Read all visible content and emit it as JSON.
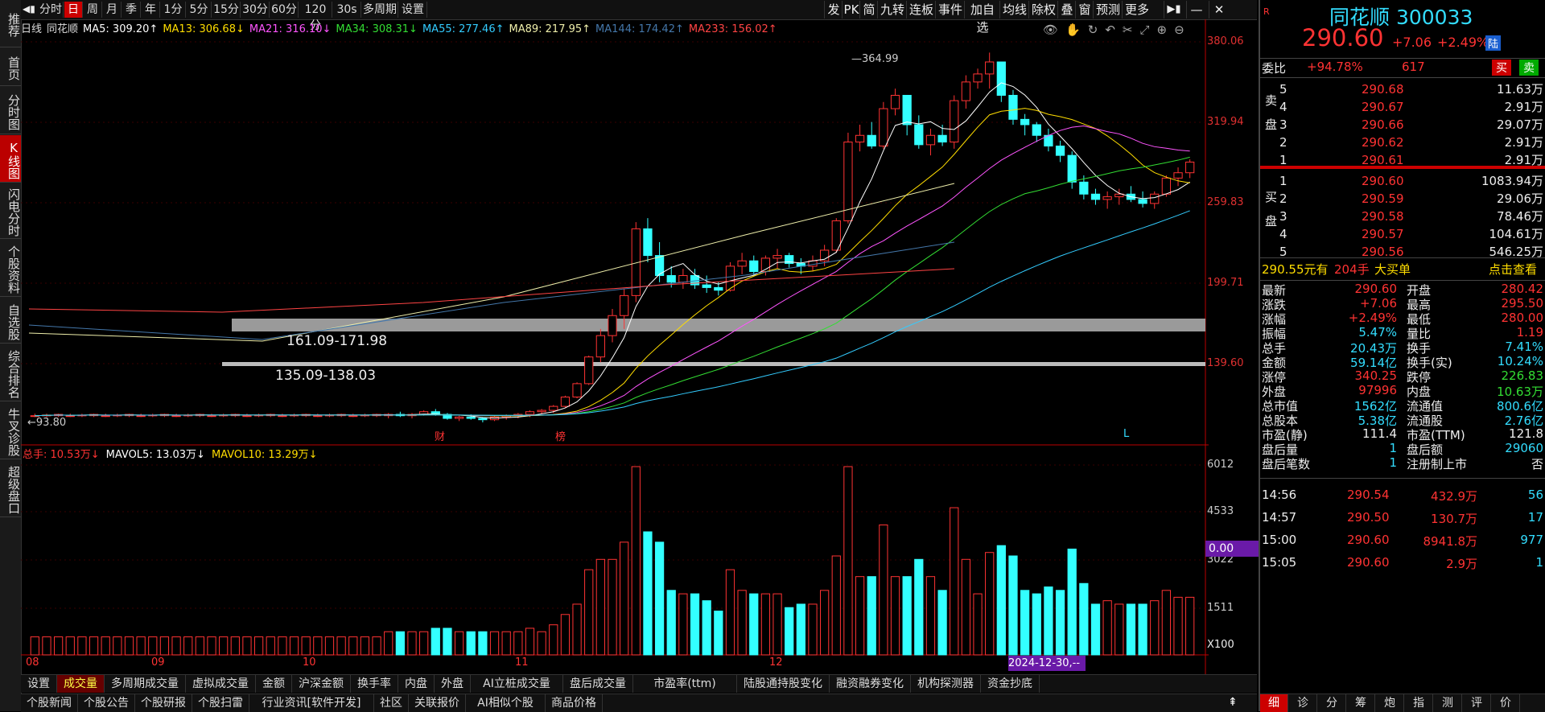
{
  "leftnav": [
    {
      "label": "推荐",
      "active": false
    },
    {
      "label": "首页",
      "active": false
    },
    {
      "label": "分时图",
      "active": false
    },
    {
      "label": "K线图",
      "active": true
    },
    {
      "label": "闪电分时",
      "active": false
    },
    {
      "label": "个股资料",
      "active": false
    },
    {
      "label": "自选股",
      "active": false
    },
    {
      "label": "综合排名",
      "active": false
    },
    {
      "label": "牛叉诊股",
      "active": false
    },
    {
      "label": "超级盘口",
      "active": false
    }
  ],
  "toolbar": {
    "periods": [
      "分时",
      "日",
      "周",
      "月",
      "季",
      "年",
      "1分",
      "5分",
      "15分",
      "30分",
      "60分",
      "120分",
      "30s",
      "多周期",
      "设置"
    ],
    "active_period": "日",
    "right_items": [
      "发",
      "PK",
      "简",
      "九转",
      "连板",
      "事件",
      "加自选",
      "均线",
      "除权",
      "叠",
      "窗",
      "预测",
      "更多"
    ]
  },
  "malegend": [
    {
      "text": "日线",
      "color": "#dddddd"
    },
    {
      "text": "同花顺",
      "color": "#dddddd"
    },
    {
      "text": "MA5: 309.20↑",
      "color": "#ffffff"
    },
    {
      "text": "MA13: 306.68↓",
      "color": "#ffdd00"
    },
    {
      "text": "MA21: 316.10↓",
      "color": "#ff55ff"
    },
    {
      "text": "MA34: 308.31↓",
      "color": "#33dd33"
    },
    {
      "text": "MA55: 277.46↑",
      "color": "#33ccff"
    },
    {
      "text": "MA89: 217.95↑",
      "color": "#eeeeaa"
    },
    {
      "text": "MA144: 174.42↑",
      "color": "#4477aa"
    },
    {
      "text": "MA233: 156.02↑",
      "color": "#ff4444"
    }
  ],
  "price_axis": [
    "380.06",
    "319.94",
    "259.83",
    "199.71",
    "139.60"
  ],
  "volume_axis": [
    "6012",
    "4533",
    "3022",
    "1511",
    "X100"
  ],
  "vol_legend": [
    {
      "text": "总手: 10.53万↓",
      "color": "#ff3333"
    },
    {
      "text": "MAVOL5: 13.03万↓",
      "color": "#ffffff"
    },
    {
      "text": "MAVOL10: 13.29万↓",
      "color": "#ffdd00"
    }
  ],
  "annotations": {
    "high": "364.99",
    "low": "93.80",
    "zone1": "161.09-171.98",
    "zone2": "135.09-138.03",
    "marker_cai": "财",
    "marker_bang": "榜",
    "marker_l": "L",
    "cursor_value": "0.00"
  },
  "date_axis": [
    "08",
    "09",
    "10",
    "11",
    "12"
  ],
  "date_highlight": "2024-12-30,--",
  "chart_data": {
    "type": "candlestick",
    "ylim": [
      93.8,
      380.06
    ],
    "candles": [
      [
        100,
        102,
        98,
        101
      ],
      [
        101,
        103,
        99,
        100
      ],
      [
        100,
        102,
        98,
        101
      ],
      [
        101,
        104,
        100,
        103
      ],
      [
        103,
        105,
        100,
        101
      ],
      [
        101,
        102,
        97,
        98
      ],
      [
        98,
        100,
        96,
        99
      ],
      [
        99,
        101,
        97,
        98
      ],
      [
        98,
        99,
        95,
        97
      ],
      [
        97,
        100,
        96,
        99
      ],
      [
        99,
        101,
        97,
        100
      ],
      [
        100,
        102,
        98,
        101
      ],
      [
        101,
        104,
        99,
        103
      ],
      [
        103,
        105,
        101,
        104
      ],
      [
        104,
        108,
        102,
        107
      ],
      [
        107,
        115,
        106,
        114
      ],
      [
        114,
        125,
        113,
        124
      ],
      [
        124,
        145,
        123,
        144
      ],
      [
        144,
        165,
        140,
        160
      ],
      [
        160,
        180,
        155,
        175
      ],
      [
        175,
        195,
        165,
        190
      ],
      [
        190,
        245,
        185,
        240
      ],
      [
        240,
        248,
        215,
        220
      ],
      [
        220,
        230,
        200,
        205
      ],
      [
        205,
        212,
        196,
        200
      ],
      [
        200,
        210,
        195,
        205
      ],
      [
        205,
        210,
        195,
        198
      ],
      [
        198,
        205,
        192,
        196
      ],
      [
        196,
        200,
        190,
        194
      ],
      [
        194,
        215,
        193,
        212
      ],
      [
        212,
        222,
        206,
        216
      ],
      [
        216,
        220,
        205,
        208
      ],
      [
        208,
        220,
        205,
        218
      ],
      [
        218,
        225,
        210,
        220
      ],
      [
        220,
        222,
        211,
        214
      ],
      [
        214,
        218,
        206,
        212
      ],
      [
        212,
        220,
        208,
        216
      ],
      [
        216,
        228,
        212,
        224
      ],
      [
        224,
        248,
        222,
        246
      ],
      [
        246,
        312,
        244,
        305
      ],
      [
        305,
        318,
        298,
        310
      ],
      [
        310,
        320,
        300,
        302
      ],
      [
        302,
        335,
        300,
        330
      ],
      [
        330,
        345,
        325,
        340
      ],
      [
        340,
        330,
        310,
        318
      ],
      [
        318,
        325,
        300,
        303
      ],
      [
        303,
        315,
        295,
        310
      ],
      [
        310,
        318,
        302,
        305
      ],
      [
        305,
        340,
        300,
        336
      ],
      [
        336,
        355,
        330,
        350
      ],
      [
        350,
        360,
        345,
        356
      ],
      [
        356,
        372,
        345,
        365
      ],
      [
        365,
        364,
        335,
        340
      ],
      [
        340,
        344,
        318,
        322
      ],
      [
        322,
        326,
        310,
        318
      ],
      [
        318,
        320,
        305,
        310
      ],
      [
        310,
        315,
        298,
        302
      ],
      [
        302,
        306,
        290,
        295
      ],
      [
        295,
        298,
        270,
        275
      ],
      [
        275,
        280,
        262,
        266
      ],
      [
        266,
        270,
        258,
        262
      ],
      [
        262,
        268,
        255,
        264
      ],
      [
        264,
        270,
        258,
        266
      ],
      [
        266,
        272,
        260,
        262
      ],
      [
        262,
        268,
        256,
        259
      ],
      [
        259,
        268,
        255,
        266
      ],
      [
        266,
        280,
        264,
        278
      ],
      [
        278,
        286,
        272,
        282
      ],
      [
        282,
        292,
        278,
        290
      ]
    ]
  },
  "quote": {
    "name": "同花顺 300033",
    "price": "290.60",
    "change": "+7.06",
    "pct": "+2.49%",
    "tag": "陆",
    "weibi_label": "委比",
    "weibi": "+94.78%",
    "weicha": "617",
    "buy_btn": "买",
    "sell_btn": "卖",
    "sell": [
      {
        "lv": "5",
        "price": "290.68",
        "vol": "11.63万"
      },
      {
        "lv": "4",
        "price": "290.67",
        "vol": "2.91万"
      },
      {
        "lv": "3",
        "price": "290.66",
        "vol": "29.07万"
      },
      {
        "lv": "2",
        "price": "290.62",
        "vol": "2.91万"
      },
      {
        "lv": "1",
        "price": "290.61",
        "vol": "2.91万"
      }
    ],
    "sell_label": "卖盘",
    "buy": [
      {
        "lv": "1",
        "price": "290.60",
        "vol": "1083.94万"
      },
      {
        "lv": "2",
        "price": "290.59",
        "vol": "29.06万"
      },
      {
        "lv": "3",
        "price": "290.58",
        "vol": "78.46万"
      },
      {
        "lv": "4",
        "price": "290.57",
        "vol": "104.61万"
      },
      {
        "lv": "5",
        "price": "290.56",
        "vol": "546.25万"
      }
    ],
    "buy_label": "买盘",
    "bigorder": {
      "a": "290.55元有",
      "b": "204手",
      "c": "大买单",
      "d": "点击查看"
    },
    "stats": [
      [
        "最新",
        "290.60",
        "red",
        "开盘",
        "280.42",
        "red"
      ],
      [
        "涨跌",
        "+7.06",
        "red",
        "最高",
        "295.50",
        "red"
      ],
      [
        "涨幅",
        "+2.49%",
        "red",
        "最低",
        "280.00",
        "red"
      ],
      [
        "振幅",
        "5.47%",
        "cyan",
        "量比",
        "1.19",
        "red"
      ],
      [
        "总手",
        "20.43万",
        "cyan",
        "换手",
        "7.41%",
        "cyan"
      ],
      [
        "金额",
        "59.14亿",
        "cyan",
        "换手(实)",
        "10.24%",
        "cyan"
      ],
      [
        "涨停",
        "340.25",
        "red",
        "跌停",
        "226.83",
        "green"
      ],
      [
        "外盘",
        "97996",
        "red",
        "内盘",
        "10.63万",
        "green"
      ],
      [
        "总市值",
        "1562亿",
        "cyan",
        "流通值",
        "800.6亿",
        "cyan"
      ],
      [
        "总股本",
        "5.38亿",
        "cyan",
        "流通股",
        "2.76亿",
        "cyan"
      ],
      [
        "市盈(静)",
        "111.4",
        "white",
        "市盈(TTM)",
        "121.8",
        "white"
      ],
      [
        "盘后量",
        "1",
        "cyan",
        "盘后额",
        "29060",
        "cyan"
      ],
      [
        "盘后笔数",
        "1",
        "cyan",
        "注册制上市",
        "否",
        "white"
      ]
    ],
    "ticks": [
      {
        "t": "14:56",
        "p": "290.54",
        "v": "432.9万",
        "n": "56"
      },
      {
        "t": "14:57",
        "p": "290.50",
        "v": "130.7万",
        "n": "17"
      },
      {
        "t": "15:00",
        "p": "290.60",
        "v": "8941.8万",
        "n": "977"
      },
      {
        "t": "15:05",
        "p": "290.60",
        "v": "2.9万",
        "n": "1"
      }
    ],
    "bottom_tabs": [
      "细",
      "诊",
      "分",
      "筹",
      "炮",
      "指",
      "测",
      "评",
      "价"
    ]
  },
  "bottom_tabs": [
    "设置",
    "成交量",
    "多周期成交量",
    "虚拟成交量",
    "金额",
    "沪深金额",
    "换手率",
    "内盘",
    "外盘",
    "AI立桩成交量",
    "盘后成交量",
    "市盈率(ttm)",
    "陆股通持股变化",
    "融资融券变化",
    "机构探测器",
    "资金抄底"
  ],
  "active_bottom_tab": "成交量",
  "bottom_links": [
    "个股新闻",
    "个股公告",
    "个股研报",
    "个股扫雷",
    "行业资讯[软件开发]",
    "社区",
    "关联报价",
    "AI相似个股",
    "商品价格"
  ]
}
